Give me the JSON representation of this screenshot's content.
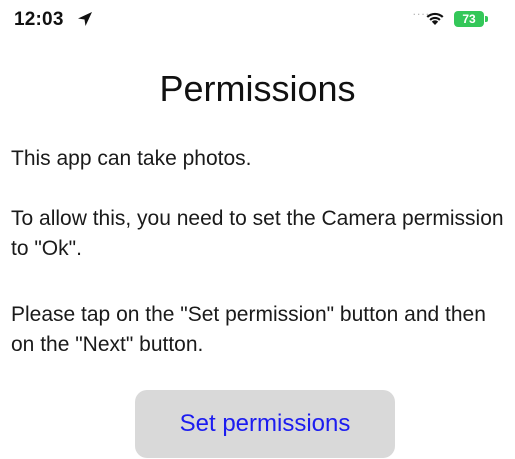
{
  "status_bar": {
    "time": "12:03",
    "location_icon": "location-arrow-icon",
    "signal": "....",
    "wifi_icon": "wifi-icon",
    "battery_level": "73",
    "battery_color": "#34c759"
  },
  "page": {
    "title": "Permissions",
    "paragraphs": [
      "This app can take photos.",
      "To allow this, you need to set the Camera permission to \"Ok\".",
      "Please tap on the \"Set permission\" button and then on the \"Next\" button."
    ]
  },
  "actions": {
    "primary_button_label": "Set permissions",
    "primary_button_color": "#1c1cf0",
    "primary_button_bg": "#d9d9d9"
  }
}
